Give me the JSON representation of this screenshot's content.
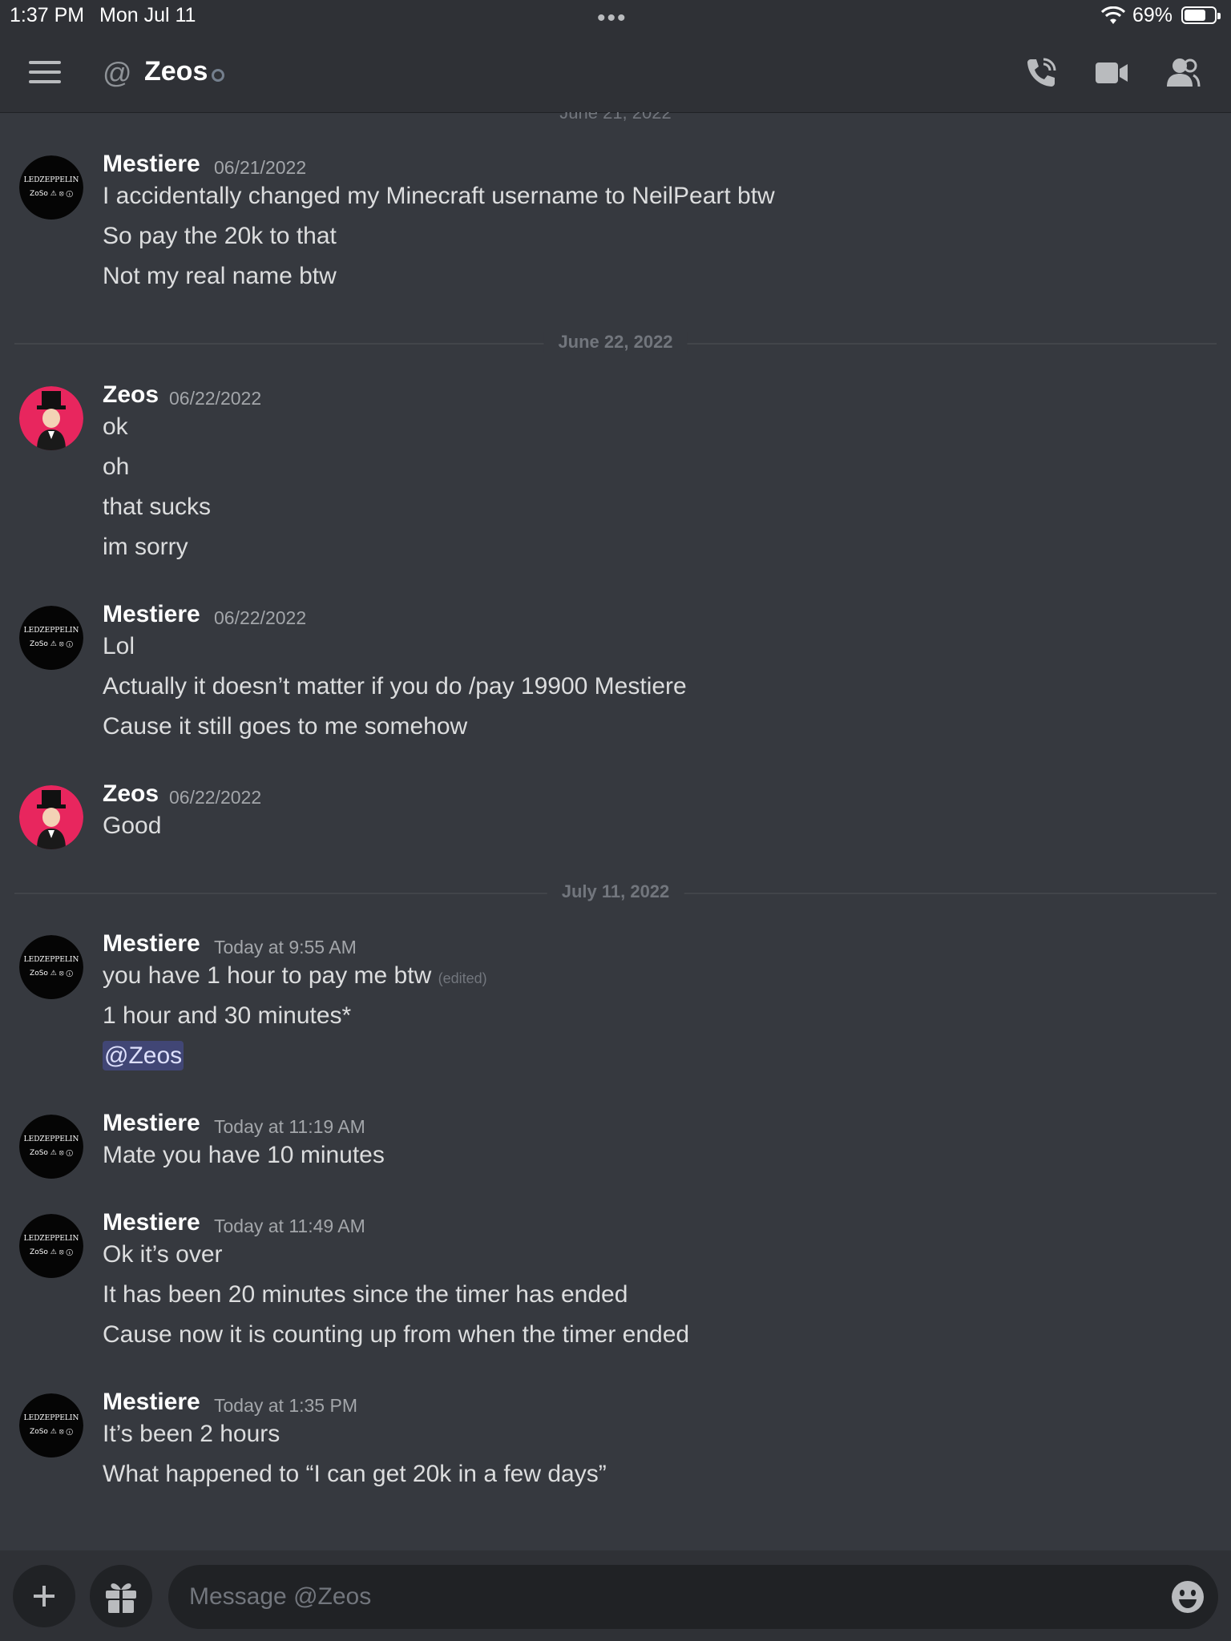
{
  "status_bar": {
    "time": "1:37 PM",
    "date": "Mon Jul 11",
    "battery": "69%"
  },
  "header": {
    "at_symbol": "@",
    "title": "Zeos"
  },
  "partial_divider": "June 21, 2022",
  "dividers": [
    "June 22, 2022",
    "July 11, 2022"
  ],
  "messages": [
    {
      "author": "Mestiere",
      "timestamp": "06/21/2022",
      "lines": [
        "I accidentally changed my Minecraft username to NeilPeart btw",
        "So pay the 20k to that",
        "Not my real name btw"
      ]
    },
    {
      "author": "Zeos",
      "timestamp": "06/22/2022",
      "lines": [
        "ok",
        "oh",
        "that sucks",
        "im sorry"
      ]
    },
    {
      "author": "Mestiere",
      "timestamp": "06/22/2022",
      "lines": [
        "Lol",
        "Actually it doesn’t matter if you do /pay 19900 Mestiere",
        "Cause it still goes to me somehow"
      ]
    },
    {
      "author": "Zeos",
      "timestamp": "06/22/2022",
      "lines": [
        "Good"
      ]
    },
    {
      "author": "Mestiere",
      "timestamp": "Today at 9:55 AM",
      "lines": [
        "you have 1 hour to pay me btw",
        "1 hour and 30 minutes*"
      ],
      "edited": "(edited)",
      "mention": "@Zeos"
    },
    {
      "author": "Mestiere",
      "timestamp": "Today at 11:19 AM",
      "lines": [
        "Mate you have 10 minutes"
      ]
    },
    {
      "author": "Mestiere",
      "timestamp": "Today at 11:49 AM",
      "lines": [
        "Ok it’s over",
        "It has been 20 minutes since the timer has ended",
        "Cause now it is counting up from when the timer ended"
      ]
    },
    {
      "author": "Mestiere",
      "timestamp": "Today at 1:35 PM",
      "lines": [
        "It’s been 2 hours",
        "What happened to “I can get 20k in a few days”"
      ]
    }
  ],
  "avatar_text": {
    "band": "LEDZEPPELIN",
    "symbols": "ZoSo ⚠ ⦻ ⓘ"
  },
  "composer": {
    "placeholder": "Message @Zeos"
  },
  "icons": [
    "hamburger-icon",
    "at-icon",
    "phone-icon",
    "video-icon",
    "members-icon",
    "plus-icon",
    "gift-icon",
    "emoji-icon",
    "wifi-icon",
    "battery-icon"
  ],
  "colors": {
    "background": "#36393f",
    "header": "#2f3136",
    "mention_bg": "#414675",
    "zeos_avatar": "#e8265e"
  }
}
